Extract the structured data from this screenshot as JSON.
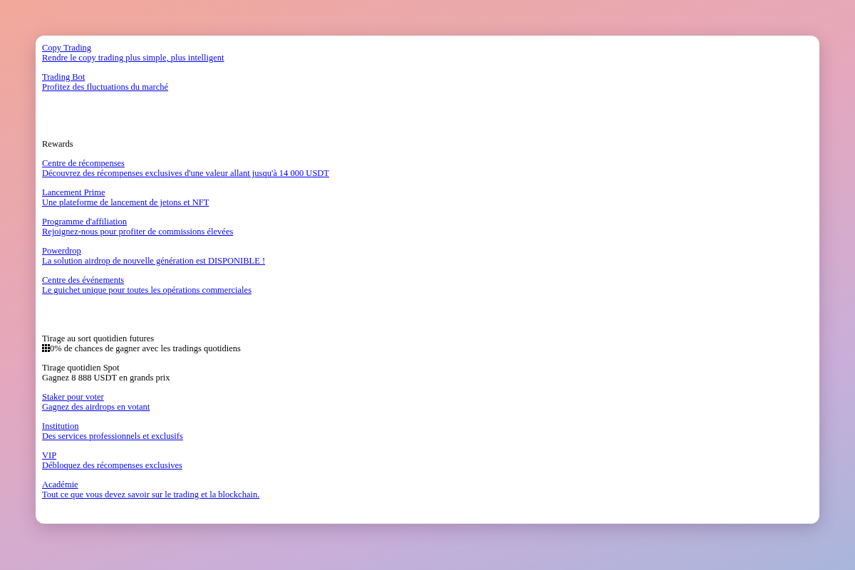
{
  "groups": [
    {
      "items": [
        {
          "kind": "link",
          "title": "Copy Trading",
          "description": "Rendre le copy trading plus simple, plus intelligent"
        },
        {
          "kind": "link",
          "title": "Trading Bot",
          "description": "Profitez des fluctuations du marché"
        }
      ]
    },
    {
      "heading": "Rewards",
      "items": [
        {
          "kind": "link",
          "title": "Centre de récompenses",
          "description": "Découvrez des récompenses exclusives d'une valeur allant jusqu'à 14 000 USDT"
        },
        {
          "kind": "link",
          "title": "Lancement Prime",
          "description": "Une plateforme de lancement de jetons et NFT"
        },
        {
          "kind": "link",
          "title": "Programme d'affiliation",
          "description": "Rejoignez-nous pour profiter de commissions élevées"
        },
        {
          "kind": "link",
          "title": "Powerdrop",
          "description": "La solution airdrop de nouvelle génération est DISPONIBLE !"
        },
        {
          "kind": "link",
          "title": "Centre des événements",
          "description": "Le guichet unique pour toutes les opérations commerciales"
        }
      ]
    },
    {
      "items": [
        {
          "kind": "plain",
          "has_icon": true,
          "title": "Tirage au sort quotidien futures",
          "description": "0% de chances de gagner avec les tradings quotidiens"
        },
        {
          "kind": "plain",
          "has_icon": false,
          "title": "Tirage quotidien Spot",
          "description": "Gagnez 8 888 USDT en grands prix"
        },
        {
          "kind": "link",
          "title": "Staker pour voter",
          "description": "Gagnez des airdrops en votant"
        },
        {
          "kind": "link",
          "title": "Institution",
          "description": "Des services professionnels et exclusifs"
        },
        {
          "kind": "link",
          "title": "VIP",
          "description": "Débloquez des récompenses exclusives"
        },
        {
          "kind": "link",
          "title": "Académie",
          "description": "Tout ce que vous devez savoir sur le trading et la blockchain."
        }
      ]
    }
  ]
}
